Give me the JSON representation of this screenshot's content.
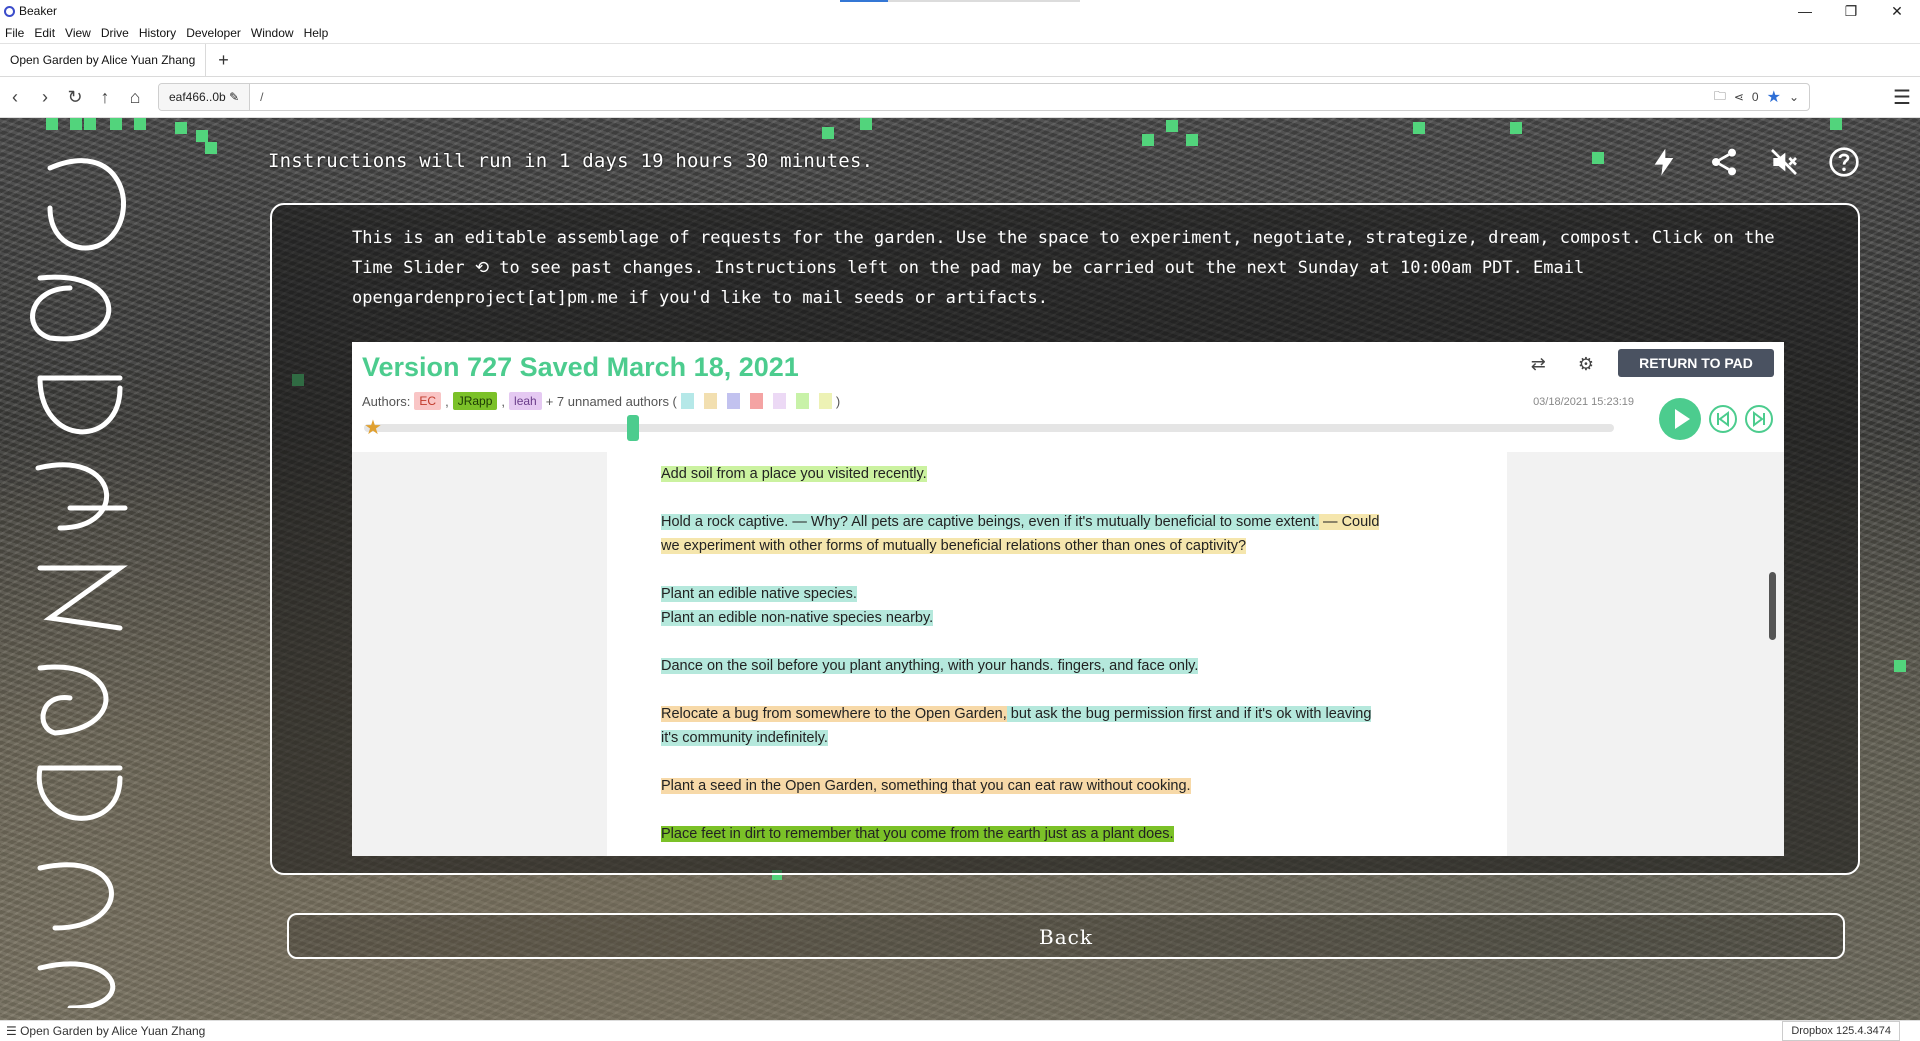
{
  "window": {
    "title": "Beaker",
    "controls": [
      "—",
      "❐",
      "✕"
    ]
  },
  "menu": [
    "File",
    "Edit",
    "View",
    "Drive",
    "History",
    "Developer",
    "Window",
    "Help"
  ],
  "tabs": [
    {
      "label": "Open Garden by Alice Yuan Zhang"
    }
  ],
  "nav": {
    "site_label": "eaf466..0b",
    "path": "/",
    "share_count": "0"
  },
  "page": {
    "countdown": "Instructions will run in 1 days 19 hours 30 minutes.",
    "intro": "This is an editable assemblage of requests for the garden. Use the space to experiment, negotiate, strategize, dream, compost. Click on the Time Slider ⟲ to see past changes. Instructions left on the pad may be carried out the next Sunday at 10:00am PDT. Email opengardenproject[at]pm.me if you'd like to mail seeds or artifacts.",
    "back_label": "Back"
  },
  "pad": {
    "version_title": "Version 727 Saved March 18, 2021",
    "authors_label": "Authors:",
    "authors": [
      {
        "name": "EC",
        "color": "#f9c5c5"
      },
      {
        "name": "JRapp",
        "color": "#7bc128"
      },
      {
        "name": "leah",
        "color": "#e5c9f2"
      }
    ],
    "unnamed": "+ 7 unnamed authors (",
    "unnamed_close": ")",
    "swatches": [
      "#b5e8e8",
      "#f2dfb0",
      "#c2c2ef",
      "#f4a3a3",
      "#ecd9f5",
      "#c8f2a8",
      "#edf2b5"
    ],
    "return_label": "RETURN TO PAD",
    "timestamp": "03/18/2021 15:23:19",
    "slider_position": 0.21,
    "lines": {
      "l1": "Add soil from a place you visited recently.",
      "l2a": "Hold a rock captive.",
      "l2b": " — Why?  All pets are captive beings, even if it's mutually beneficial to some extent.",
      "l2c": " — Could",
      "l2d": "we experiment with other forms of mutually beneficial relations other than ones of captivity?",
      "l3": "Plant an edible native species. ",
      "l4": "Plant an edible non-native species nearby.",
      "l5": "Dance on the soil before you plant anything, with your hands. fingers, and face only.",
      "l6a": "Relocate a bug from somewhere to the Open Garden,",
      "l6b": " but ask the bug permission first and if it's ok with leaving",
      "l6c": "it's community indefinitely.",
      "l7": "Plant a seed in the Open Garden, something that you can eat raw without cooking.",
      "l8": "Place feet in dirt to remember that you come from the earth just as a plant does."
    }
  },
  "status": {
    "left": "☰ Open Garden by Alice Yuan Zhang",
    "right": "Dropbox 125.4.3474"
  },
  "colors": {
    "accent": "#4ccc8e",
    "square": "#52d47c"
  }
}
